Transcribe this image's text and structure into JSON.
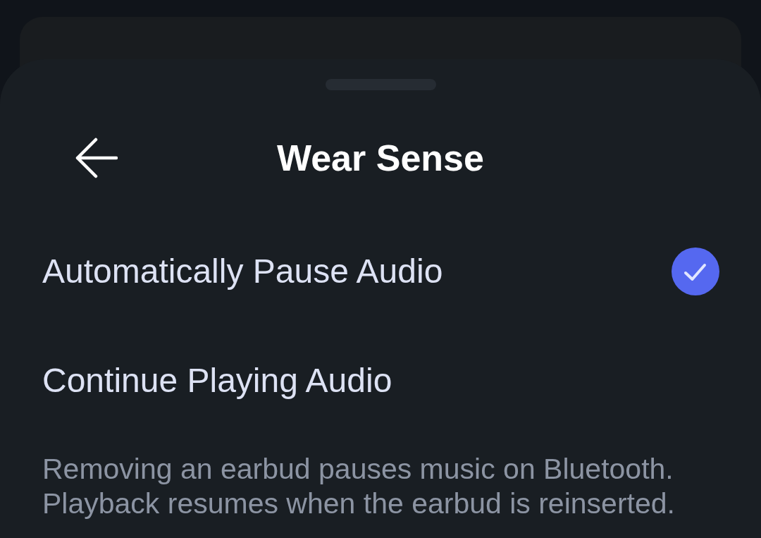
{
  "sheet": {
    "title": "Wear Sense"
  },
  "options": [
    {
      "label": "Automatically Pause Audio",
      "selected": true
    },
    {
      "label": "Continue Playing Audio",
      "selected": false
    }
  ],
  "description": "Removing an earbud pauses music on Bluetooth. Playback resumes when the earbud is reinserted."
}
